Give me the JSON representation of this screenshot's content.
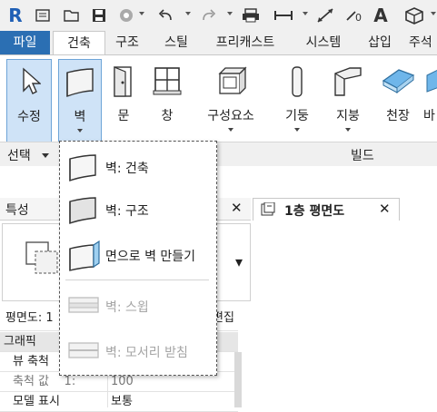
{
  "quick_access": {
    "app_logo": "R",
    "icons": [
      "home-icon",
      "open-icon",
      "save-icon",
      "sync-icon",
      "undo-icon",
      "redo-icon",
      "print-icon",
      "measure-icon",
      "dimension-icon",
      "text-icon",
      "3d-view-icon"
    ]
  },
  "ribbon_tabs": [
    {
      "label": "파일"
    },
    {
      "label": "건축"
    },
    {
      "label": "구조"
    },
    {
      "label": "스틸"
    },
    {
      "label": "프리캐스트"
    },
    {
      "label": "시스템"
    },
    {
      "label": "삽입"
    },
    {
      "label": "주석"
    }
  ],
  "ribbon_buttons": {
    "modify": "수정",
    "wall": "벽",
    "door": "문",
    "window": "창",
    "component": "구성요소",
    "column": "기둥",
    "roof": "지붕",
    "ceiling": "천장",
    "floor_partial": "바"
  },
  "panels": {
    "select": "선택",
    "build": "빌드"
  },
  "wall_menu": {
    "items": [
      {
        "label": "벽: 건축",
        "enabled": true
      },
      {
        "label": "벽: 구조",
        "enabled": true
      },
      {
        "label": "면으로 벽 만들기",
        "enabled": true
      },
      {
        "label": "벽: 스윕",
        "enabled": false
      },
      {
        "label": "벽: 모서리 받침",
        "enabled": false
      }
    ]
  },
  "properties": {
    "title": "특성",
    "close": "✕",
    "type_selector_dropdown": "▾",
    "view_label": "평면도: 1",
    "edit_type": "편집",
    "group_graphics": "그래픽",
    "rows": [
      {
        "name": "뷰 축척",
        "value": ""
      },
      {
        "name": "축척 값    1:",
        "value": "100"
      },
      {
        "name": "모델 표시",
        "value": "보통"
      }
    ]
  },
  "view_tab": {
    "label": "1층 평면도",
    "close": "✕"
  }
}
